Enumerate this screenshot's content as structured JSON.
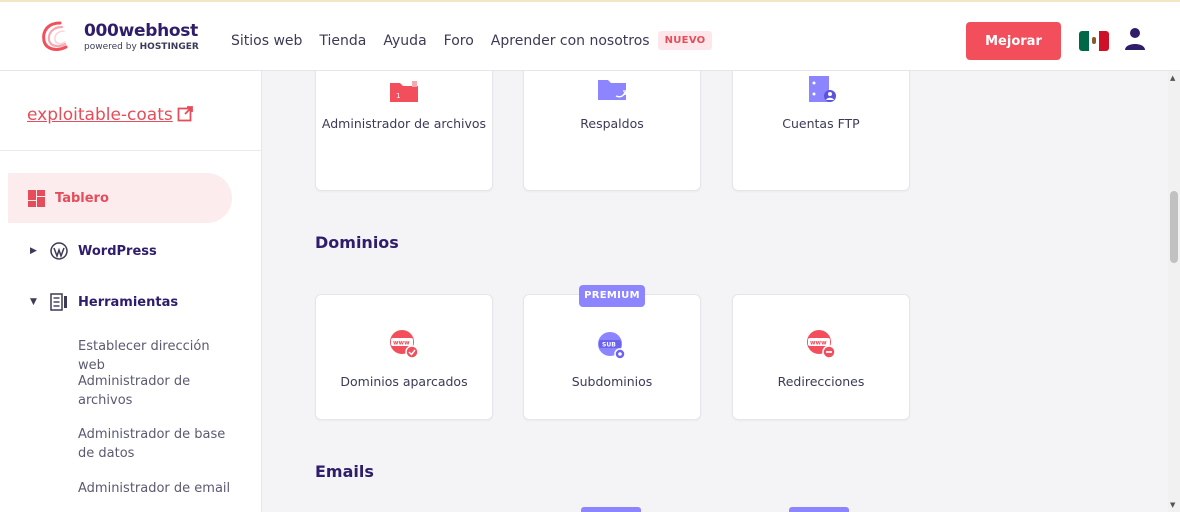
{
  "header": {
    "brand": "000webhost",
    "powered_prefix": "powered by ",
    "powered_brand": "HOSTINGER",
    "nav": [
      "Sitios web",
      "Tienda",
      "Ayuda",
      "Foro",
      "Aprender con nosotros"
    ],
    "new_badge": "NUEVO",
    "upgrade_label": "Mejorar",
    "flag_colors": [
      "#006847",
      "#ffffff",
      "#ce1126"
    ]
  },
  "sidebar": {
    "site_name": "exploitable-coats",
    "items": [
      {
        "label": "Tablero",
        "icon": "dashboard-icon",
        "active": true
      },
      {
        "label": "WordPress",
        "icon": "wordpress-icon",
        "expanded": false
      },
      {
        "label": "Herramientas",
        "icon": "tools-icon",
        "expanded": true
      }
    ],
    "sub_items": [
      "Establecer dirección web",
      "Administrador de archivos",
      "Administrador de base de datos",
      "Administrador de email"
    ]
  },
  "main": {
    "top_cards": [
      {
        "label": "Administrador de archivos",
        "icon": "file-manager-icon"
      },
      {
        "label": "Respaldos",
        "icon": "backups-icon"
      },
      {
        "label": "Cuentas FTP",
        "icon": "ftp-accounts-icon"
      }
    ],
    "domains_title": "Dominios",
    "domain_cards": [
      {
        "label": "Dominios aparcados",
        "icon": "parked-domains-icon"
      },
      {
        "label": "Subdominios",
        "icon": "subdomains-icon",
        "badge": "PREMIUM"
      },
      {
        "label": "Redirecciones",
        "icon": "redirects-icon"
      }
    ],
    "emails_title": "Emails"
  },
  "colors": {
    "accent": "#f24e5c",
    "brand": "#2f1c6a",
    "premium": "#8c85ff"
  }
}
